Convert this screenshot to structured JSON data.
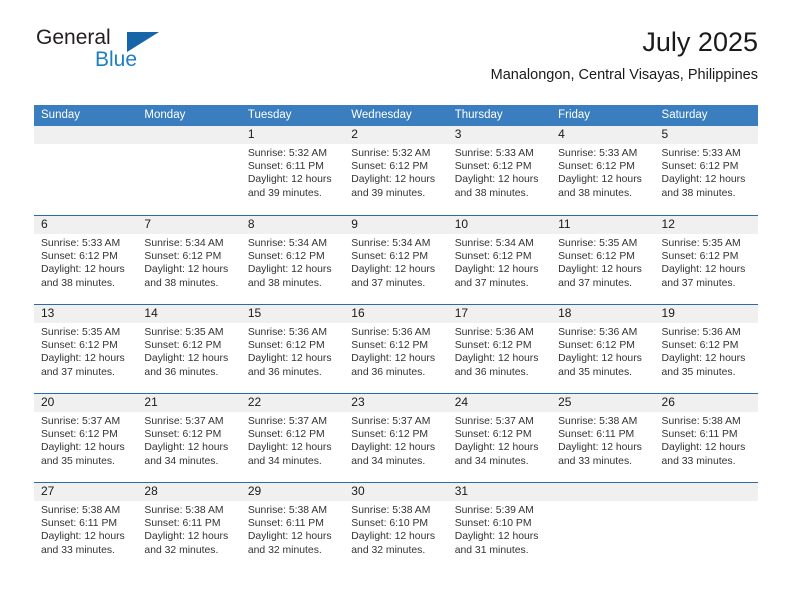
{
  "brand": {
    "name_primary": "General",
    "name_secondary": "Blue",
    "accent_color": "#1d7fc3",
    "triangle_color": "#1565a8"
  },
  "header": {
    "month_title": "July 2025",
    "location": "Manalongon, Central Visayas, Philippines"
  },
  "calendar": {
    "header_bg": "#3a7ebf",
    "row_divider_color": "#2b6ca8",
    "date_band_bg": "#f0f0f0",
    "weekdays": [
      "Sunday",
      "Monday",
      "Tuesday",
      "Wednesday",
      "Thursday",
      "Friday",
      "Saturday"
    ],
    "weeks": [
      [
        {
          "date": "",
          "sunrise": "",
          "sunset": "",
          "daylight": ""
        },
        {
          "date": "",
          "sunrise": "",
          "sunset": "",
          "daylight": ""
        },
        {
          "date": "1",
          "sunrise": "Sunrise: 5:32 AM",
          "sunset": "Sunset: 6:11 PM",
          "daylight": "Daylight: 12 hours and 39 minutes."
        },
        {
          "date": "2",
          "sunrise": "Sunrise: 5:32 AM",
          "sunset": "Sunset: 6:12 PM",
          "daylight": "Daylight: 12 hours and 39 minutes."
        },
        {
          "date": "3",
          "sunrise": "Sunrise: 5:33 AM",
          "sunset": "Sunset: 6:12 PM",
          "daylight": "Daylight: 12 hours and 38 minutes."
        },
        {
          "date": "4",
          "sunrise": "Sunrise: 5:33 AM",
          "sunset": "Sunset: 6:12 PM",
          "daylight": "Daylight: 12 hours and 38 minutes."
        },
        {
          "date": "5",
          "sunrise": "Sunrise: 5:33 AM",
          "sunset": "Sunset: 6:12 PM",
          "daylight": "Daylight: 12 hours and 38 minutes."
        }
      ],
      [
        {
          "date": "6",
          "sunrise": "Sunrise: 5:33 AM",
          "sunset": "Sunset: 6:12 PM",
          "daylight": "Daylight: 12 hours and 38 minutes."
        },
        {
          "date": "7",
          "sunrise": "Sunrise: 5:34 AM",
          "sunset": "Sunset: 6:12 PM",
          "daylight": "Daylight: 12 hours and 38 minutes."
        },
        {
          "date": "8",
          "sunrise": "Sunrise: 5:34 AM",
          "sunset": "Sunset: 6:12 PM",
          "daylight": "Daylight: 12 hours and 38 minutes."
        },
        {
          "date": "9",
          "sunrise": "Sunrise: 5:34 AM",
          "sunset": "Sunset: 6:12 PM",
          "daylight": "Daylight: 12 hours and 37 minutes."
        },
        {
          "date": "10",
          "sunrise": "Sunrise: 5:34 AM",
          "sunset": "Sunset: 6:12 PM",
          "daylight": "Daylight: 12 hours and 37 minutes."
        },
        {
          "date": "11",
          "sunrise": "Sunrise: 5:35 AM",
          "sunset": "Sunset: 6:12 PM",
          "daylight": "Daylight: 12 hours and 37 minutes."
        },
        {
          "date": "12",
          "sunrise": "Sunrise: 5:35 AM",
          "sunset": "Sunset: 6:12 PM",
          "daylight": "Daylight: 12 hours and 37 minutes."
        }
      ],
      [
        {
          "date": "13",
          "sunrise": "Sunrise: 5:35 AM",
          "sunset": "Sunset: 6:12 PM",
          "daylight": "Daylight: 12 hours and 37 minutes."
        },
        {
          "date": "14",
          "sunrise": "Sunrise: 5:35 AM",
          "sunset": "Sunset: 6:12 PM",
          "daylight": "Daylight: 12 hours and 36 minutes."
        },
        {
          "date": "15",
          "sunrise": "Sunrise: 5:36 AM",
          "sunset": "Sunset: 6:12 PM",
          "daylight": "Daylight: 12 hours and 36 minutes."
        },
        {
          "date": "16",
          "sunrise": "Sunrise: 5:36 AM",
          "sunset": "Sunset: 6:12 PM",
          "daylight": "Daylight: 12 hours and 36 minutes."
        },
        {
          "date": "17",
          "sunrise": "Sunrise: 5:36 AM",
          "sunset": "Sunset: 6:12 PM",
          "daylight": "Daylight: 12 hours and 36 minutes."
        },
        {
          "date": "18",
          "sunrise": "Sunrise: 5:36 AM",
          "sunset": "Sunset: 6:12 PM",
          "daylight": "Daylight: 12 hours and 35 minutes."
        },
        {
          "date": "19",
          "sunrise": "Sunrise: 5:36 AM",
          "sunset": "Sunset: 6:12 PM",
          "daylight": "Daylight: 12 hours and 35 minutes."
        }
      ],
      [
        {
          "date": "20",
          "sunrise": "Sunrise: 5:37 AM",
          "sunset": "Sunset: 6:12 PM",
          "daylight": "Daylight: 12 hours and 35 minutes."
        },
        {
          "date": "21",
          "sunrise": "Sunrise: 5:37 AM",
          "sunset": "Sunset: 6:12 PM",
          "daylight": "Daylight: 12 hours and 34 minutes."
        },
        {
          "date": "22",
          "sunrise": "Sunrise: 5:37 AM",
          "sunset": "Sunset: 6:12 PM",
          "daylight": "Daylight: 12 hours and 34 minutes."
        },
        {
          "date": "23",
          "sunrise": "Sunrise: 5:37 AM",
          "sunset": "Sunset: 6:12 PM",
          "daylight": "Daylight: 12 hours and 34 minutes."
        },
        {
          "date": "24",
          "sunrise": "Sunrise: 5:37 AM",
          "sunset": "Sunset: 6:12 PM",
          "daylight": "Daylight: 12 hours and 34 minutes."
        },
        {
          "date": "25",
          "sunrise": "Sunrise: 5:38 AM",
          "sunset": "Sunset: 6:11 PM",
          "daylight": "Daylight: 12 hours and 33 minutes."
        },
        {
          "date": "26",
          "sunrise": "Sunrise: 5:38 AM",
          "sunset": "Sunset: 6:11 PM",
          "daylight": "Daylight: 12 hours and 33 minutes."
        }
      ],
      [
        {
          "date": "27",
          "sunrise": "Sunrise: 5:38 AM",
          "sunset": "Sunset: 6:11 PM",
          "daylight": "Daylight: 12 hours and 33 minutes."
        },
        {
          "date": "28",
          "sunrise": "Sunrise: 5:38 AM",
          "sunset": "Sunset: 6:11 PM",
          "daylight": "Daylight: 12 hours and 32 minutes."
        },
        {
          "date": "29",
          "sunrise": "Sunrise: 5:38 AM",
          "sunset": "Sunset: 6:11 PM",
          "daylight": "Daylight: 12 hours and 32 minutes."
        },
        {
          "date": "30",
          "sunrise": "Sunrise: 5:38 AM",
          "sunset": "Sunset: 6:10 PM",
          "daylight": "Daylight: 12 hours and 32 minutes."
        },
        {
          "date": "31",
          "sunrise": "Sunrise: 5:39 AM",
          "sunset": "Sunset: 6:10 PM",
          "daylight": "Daylight: 12 hours and 31 minutes."
        },
        {
          "date": "",
          "sunrise": "",
          "sunset": "",
          "daylight": ""
        },
        {
          "date": "",
          "sunrise": "",
          "sunset": "",
          "daylight": ""
        }
      ]
    ]
  }
}
